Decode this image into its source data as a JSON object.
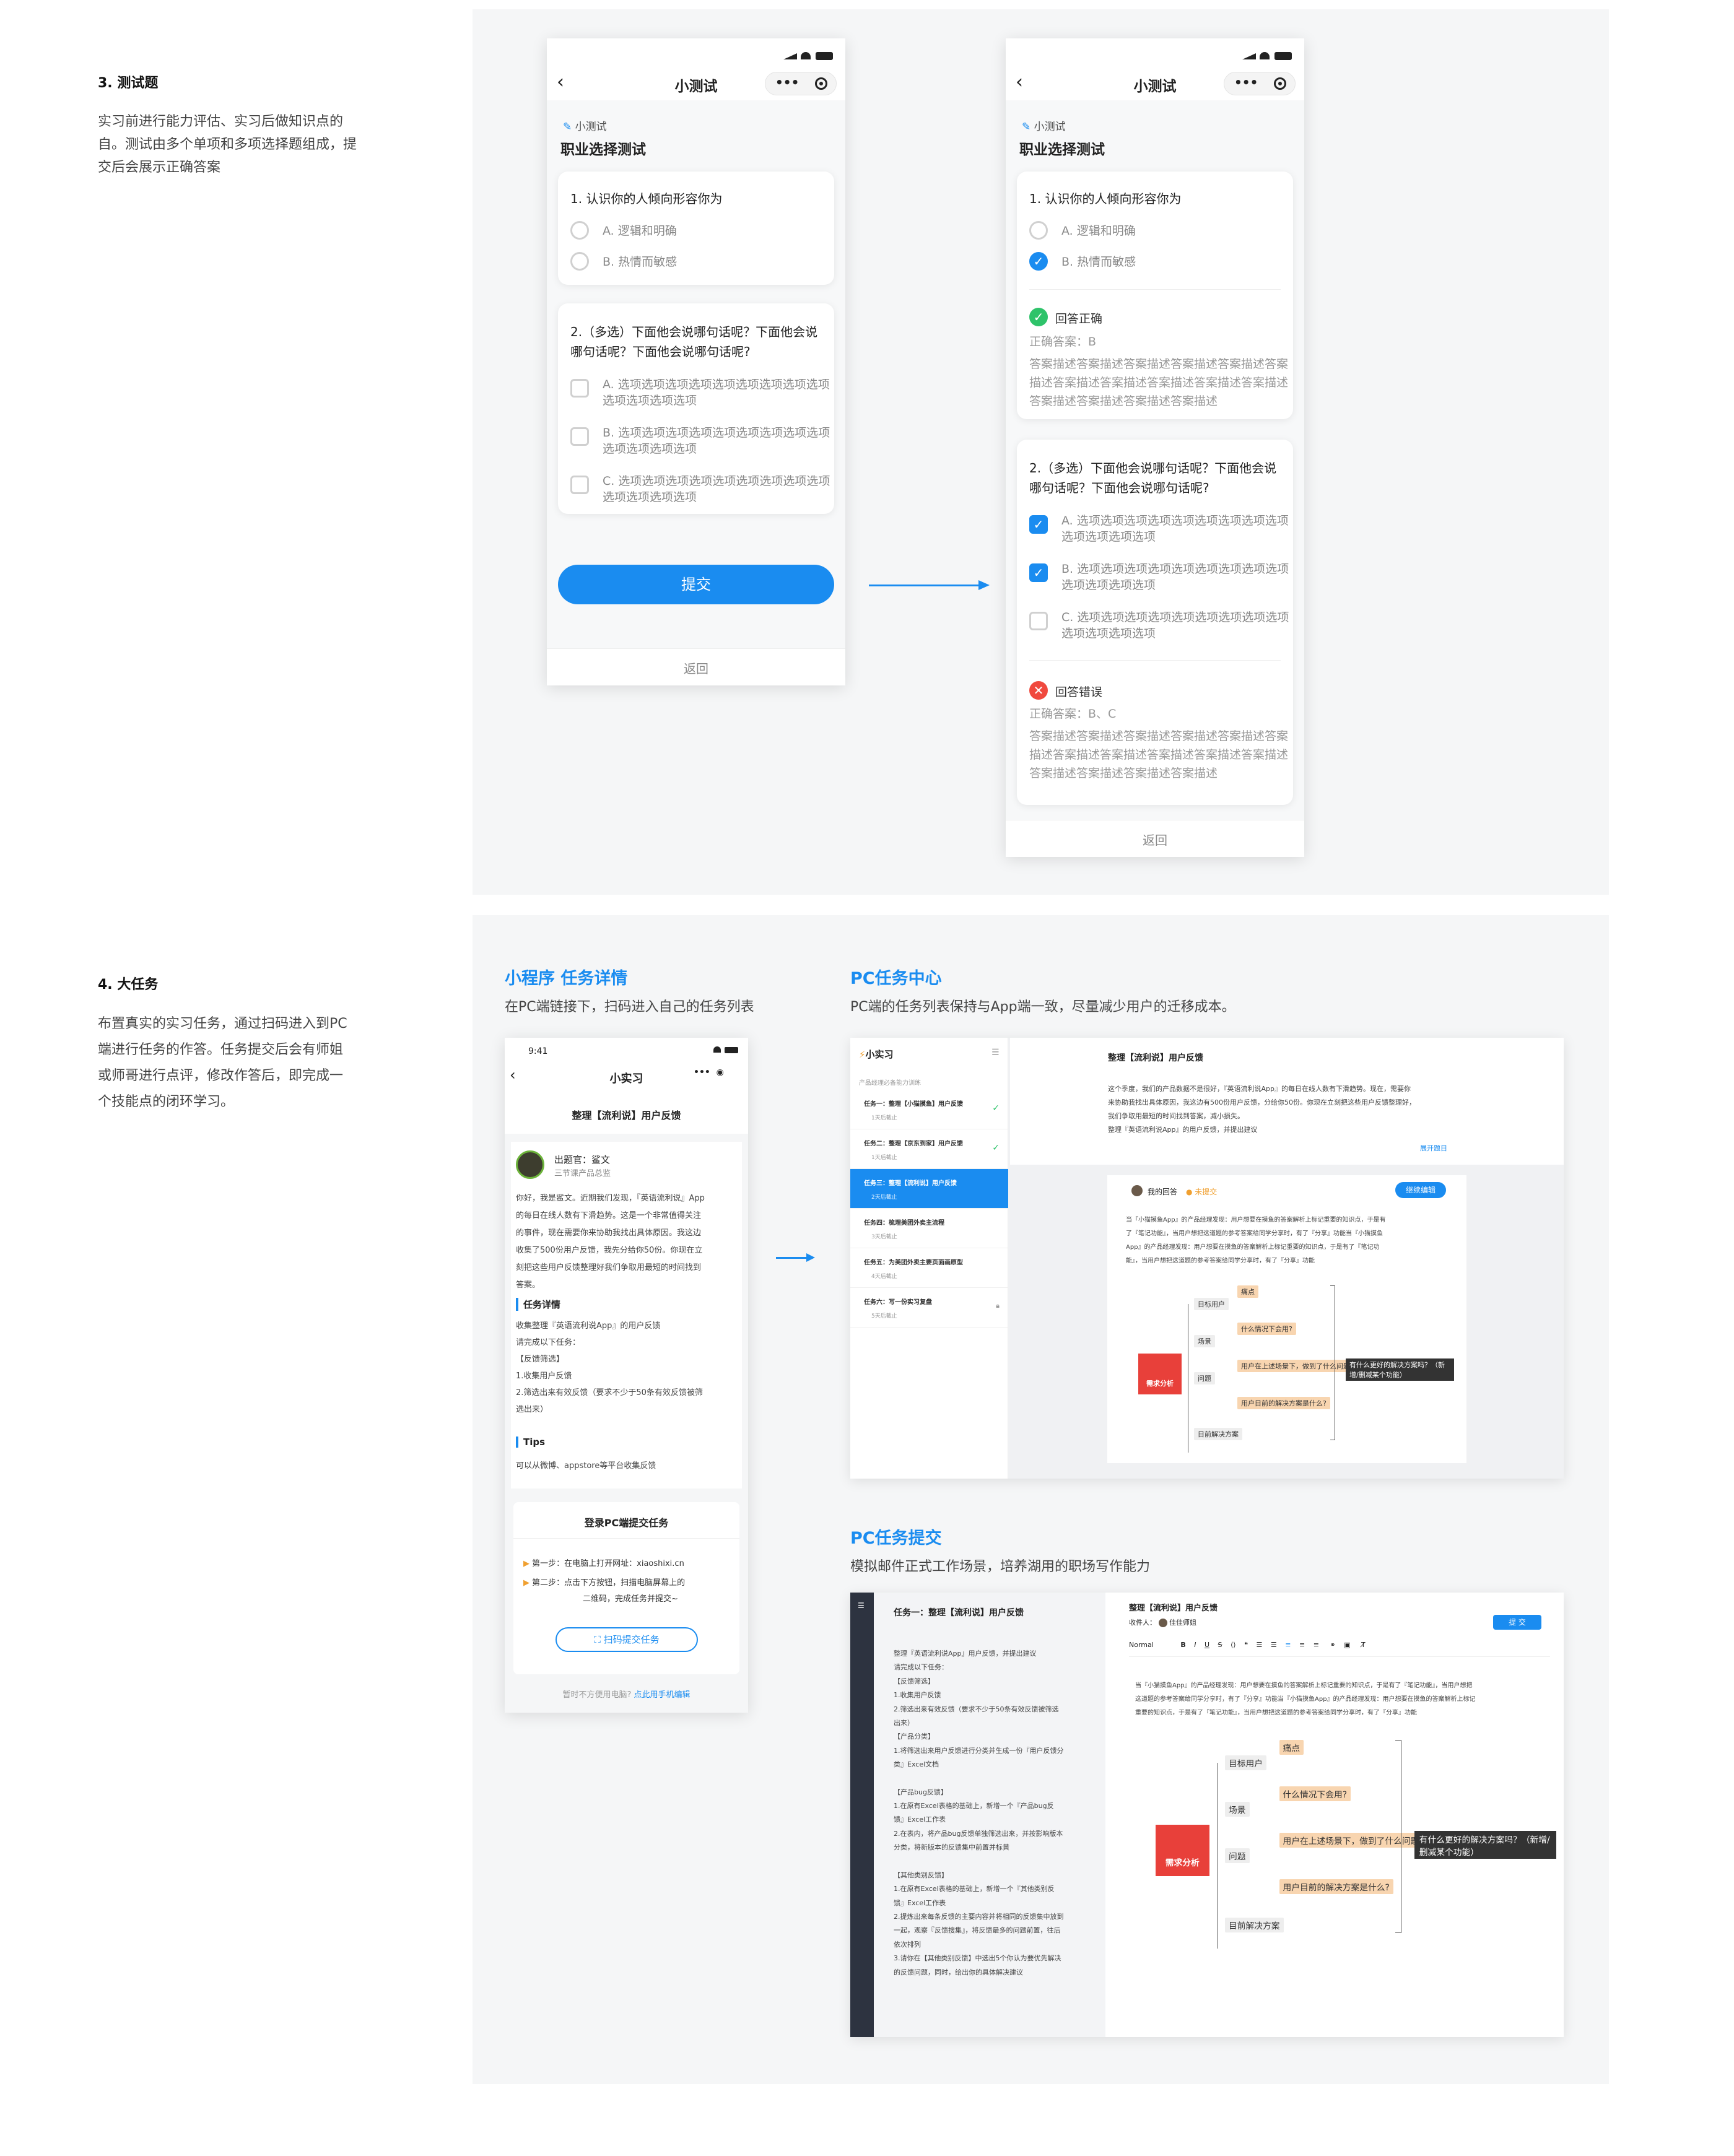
{
  "section3": {
    "title": "3. 测试题",
    "desc": [
      "实习前进行能力评估、实习后做知识点的",
      "自。测试由多个单项和多项选择题组成，提",
      "交后会展示正确答案"
    ]
  },
  "section4": {
    "title": "4. 大任务",
    "desc": [
      "布置真实的实习任务，通过扫码进入到PC",
      "端进行任务的作答。任务提交后会有师姐",
      "或师哥进行点评，修改作答后，即完成一",
      "个技能点的闭环学习。"
    ]
  },
  "quiz": {
    "nav_title": "小测试",
    "tag": "小测试",
    "title": "职业选择测试",
    "q1": "1. 认识你的人倾向形容你为",
    "q1_opts": [
      "A. 逻辑和明确",
      "B. 热情而敏感"
    ],
    "q2": [
      "2.（多选）下面他会说哪句话呢？下面他会说",
      "哪句话呢？下面他会说哪句话呢?"
    ],
    "q2_opts": [
      [
        "A. 选项选项选项选项选项选项选项选项选项",
        "选项选项选项选项"
      ],
      [
        "B. 选项选项选项选项选项选项选项选项选项",
        "选项选项选项选项"
      ],
      [
        "C. 选项选项选项选项选项选项选项选项选项",
        "选项选项选项选项"
      ]
    ],
    "submit": "提交",
    "back": "返回",
    "correct_label": "回答正确",
    "correct_answer": "正确答案：B",
    "wrong_label": "回答错误",
    "wrong_answer": "正确答案：B、C",
    "explain": [
      "答案描述答案描述答案描述答案描述答案描述答案",
      "描述答案描述答案描述答案描述答案描述答案描述",
      "答案描述答案描述答案描述答案描述"
    ],
    "selected": {
      "q1": 1,
      "q2": [
        0,
        1
      ]
    }
  },
  "mini": {
    "heading": "小程序 任务详情",
    "sub": "在PC端链接下，扫码进入自己的任务列表",
    "time": "9:41",
    "nav_title": "小实习",
    "task_title": "整理【流利说】用户反馈",
    "author_name": "出题官：鲨文",
    "author_role": "三节课产品总监",
    "intro": [
      "你好，我是鲨文。近期我们发现，『英语流利说』App",
      "的每日在线人数有下滑趋势。这是一个非常值得关注",
      "的事件，现在需要你来协助我找出具体原因。我这边",
      "收集了500份用户反馈，我先分给你50份。你现在立",
      "刻把这些用户反馈整理好我们争取用最短的时间找到",
      "答案。"
    ],
    "detail_head": "任务详情",
    "detail": [
      "收集整理『英语流利说App』的用户反馈",
      "请完成以下任务：",
      "【反馈筛选】",
      "1.收集用户反馈",
      "2.筛选出来有效反馈（要求不少于50条有效反馈被筛",
      "选出来）"
    ],
    "tips_head": "Tips",
    "tips": "可以从微博、appstore等平台收集反馈",
    "login_head": "登录PC端提交任务",
    "step1": "第一步：在电脑上打开网址：xiaoshixi.cn",
    "step2": [
      "第二步：点击下方按钮，扫描电脑屏幕上的",
      "二维码，完成任务并提交~"
    ],
    "scan_btn": "扫码提交任务",
    "footer_a": "暂时不方便用电脑?",
    "footer_b": "点此用手机编辑"
  },
  "pc_center": {
    "heading": "PC任务中心",
    "sub": "PC端的任务列表保持与App端一致，尽量减少用户的迁移成本。",
    "logo": "小实习",
    "list_caption": "产品经理必备能力训练",
    "tasks": [
      {
        "t": "任务一：整理【小猫摸鱼】用户反馈",
        "d": "1天后截止"
      },
      {
        "t": "任务二：整理【京东到家】用户反馈",
        "d": "1天后截止"
      },
      {
        "t": "任务三：整理【流利说】用户反馈",
        "d": "2天后截止"
      },
      {
        "t": "任务四：梳理美团外卖主流程",
        "d": "3天后截止"
      },
      {
        "t": "任务五：为美团外卖主要页面画原型",
        "d": "4天后截止"
      },
      {
        "t": "任务六：写一份实习复盘",
        "d": "5天后截止"
      }
    ],
    "detail_title": "整理【流利说】用户反馈",
    "detail_text": [
      "这个季度，我们的产品数据不是很好，『英语流利说App』的每日在线人数有下滑趋势。现在，需要你",
      "来协助我找出具体原因，我这边有500份用户反馈，分给你50份。你现在立刻把这些用户反馈整理好，",
      "我们争取用最短的时间找到答案，减小损失。",
      "整理『英语流利说App』的用户反馈，并提出建议"
    ],
    "expand": "展开题目",
    "answer_label": "我的回答",
    "answer_status": "未提交",
    "edit_btn": "继续编辑",
    "answer_text": [
      "当『小猫摸鱼App』的产品经理发现：用户想要在摸鱼的答案解析上标记重要的知识点，于是有",
      "了『笔记功能』，当用户想把这道题的参考答案给同学分享时，有了『分享』功能当『小猫摸鱼",
      "App』的产品经理发现：用户想要在摸鱼的答案解析上标记重要的知识点，于是有了『笔记功",
      "能』，当用户想把这道题的参考答案给同学分享时，有了『分享』功能"
    ]
  },
  "pc_submit": {
    "heading": "PC任务提交",
    "sub": "模拟邮件正式工作场景，培养湖用的职场写作能力",
    "left_title": "任务一：整理【流利说】用户反馈",
    "left_text": [
      "整理『英语流利说App』用户反馈，并提出建议",
      "请完成以下任务：",
      "【反馈筛选】",
      "1.收集用户反馈",
      "2.筛选出来有效反馈（要求不少于50条有效反馈被筛选",
      "出来）",
      "【产品分类】",
      "1.将筛选出来用户反馈进行分类并生成一份『用户反馈分",
      "类』Excel文档",
      "",
      "【产品bug反馈】",
      "1.在原有Excel表格的基础上，新增一个『产品bug反",
      "馈』Excel工作表",
      "2.在表内，将产品bug反馈单独筛选出来，并按影响版本",
      "分类，将新版本的反馈集中前置并标黄",
      "",
      "【其他类别反馈】",
      "1.在原有Excel表格的基础上，新增一个『其他类别反",
      "馈』Excel工作表",
      "2.提炼出来每条反馈的主要内容并将相同的反馈集中放到",
      "一起，观察『反馈搜集』，将反馈最多的问题前置，往后",
      "依次排列",
      "3.请你在【其他类别反馈】中选出5个你认为要优先解决",
      "的反馈问题，同时，给出你的具体解决建议"
    ],
    "mail_title": "整理【流利说】用户反馈",
    "recipient_label": "收件人：",
    "recipient": "佳佳师姐",
    "send_btn": "提 交",
    "toolbar_style": "Normal",
    "toolbar_size": "ⅰ",
    "body": [
      "当『小猫摸鱼App』的产品经理发现：用户想要在摸鱼的答案解析上标记重要的知识点，于是有了『笔记功能』，当用户想把",
      "这道题的参考答案给同学分享时，有了『分享』功能当『小猫摸鱼App』的产品经理发现：用户想要在摸鱼的答案解析上标记",
      "重要的知识点，于是有了『笔记功能』，当用户想把这道题的参考答案给同学分享时，有了『分享』功能"
    ]
  },
  "mindmap": {
    "center": "需求分析",
    "nodes": [
      "目标用户",
      "痛点",
      "场景",
      "什么情况下会用?",
      "问题",
      "用户在上述场景下，做到了什么问题?",
      "用户目前的解决方案是什么?",
      "目前解决方案"
    ],
    "goal": "有什么更好的解决方案吗？（新增/删减某个功能）"
  },
  "colors": {
    "accent": "#1a8cf0",
    "ok": "#2ec36a",
    "err": "#f0493e",
    "dark": "#2d3340"
  }
}
